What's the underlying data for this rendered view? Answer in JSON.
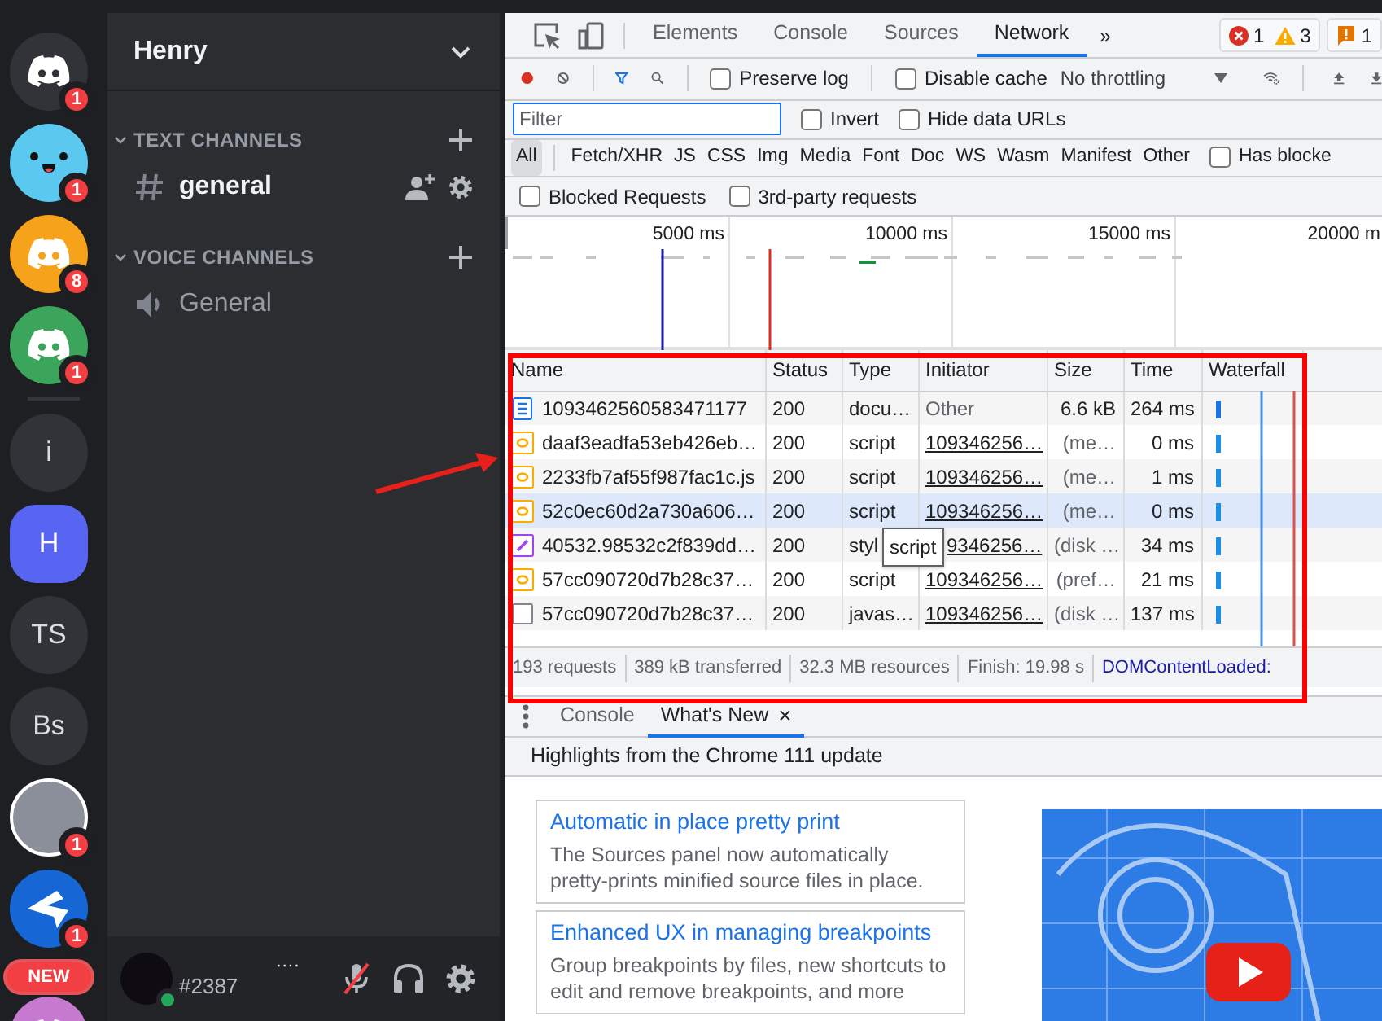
{
  "discord": {
    "servers": [
      {
        "kind": "logo",
        "color": "#313338",
        "badge": "1",
        "selected": false
      },
      {
        "kind": "face",
        "color": "#5bc8f0",
        "badge": "1",
        "selected": false
      },
      {
        "kind": "logo",
        "color": "#f7a21b",
        "badge": "8",
        "selected": false
      },
      {
        "kind": "logo",
        "color": "#3ba55c",
        "badge": "1",
        "selected": false
      },
      {
        "kind": "divider"
      },
      {
        "kind": "text",
        "label": "i",
        "color": "#313338",
        "selected": false
      },
      {
        "kind": "text",
        "label": "H",
        "color": "#5865f2",
        "selected": true
      },
      {
        "kind": "text",
        "label": "TS",
        "color": "#313338",
        "selected": false
      },
      {
        "kind": "text",
        "label": "Bs",
        "color": "#313338",
        "selected": false
      },
      {
        "kind": "photo",
        "badge": "1",
        "selected": false
      },
      {
        "kind": "arrow",
        "color": "#1766d6",
        "badge": "1",
        "selected": false
      },
      {
        "kind": "logo",
        "color": "#c57ad0",
        "pill": "NEW",
        "selected": false
      }
    ],
    "server_name": "Henry",
    "categories": [
      {
        "label": "TEXT CHANNELS",
        "expanded": true,
        "channels": [
          {
            "kind": "text",
            "name": "general",
            "unread": true
          }
        ]
      },
      {
        "label": "VOICE CHANNELS",
        "expanded": true,
        "channels": [
          {
            "kind": "voice",
            "name": "General",
            "unread": false
          }
        ]
      }
    ],
    "user": {
      "name": "····",
      "tag": "#2387",
      "muted": true
    }
  },
  "devtools": {
    "tabs": [
      {
        "label": "Elements",
        "selected": false
      },
      {
        "label": "Console",
        "selected": false
      },
      {
        "label": "Sources",
        "selected": false
      },
      {
        "label": "Network",
        "selected": true
      }
    ],
    "more_tabs": "»",
    "counters": [
      {
        "kind": "error",
        "count": "1"
      },
      {
        "kind": "warning",
        "count": "3"
      },
      {
        "kind": "issue",
        "count": "1"
      }
    ],
    "toolbar": {
      "recording": true,
      "options": [
        {
          "label": "Preserve log",
          "checked": false
        },
        {
          "label": "Disable cache",
          "checked": false
        }
      ],
      "throttling": "No throttling"
    },
    "filter": {
      "placeholder": "Filter",
      "options": [
        {
          "label": "Invert",
          "checked": false
        },
        {
          "label": "Hide data URLs",
          "checked": false
        }
      ]
    },
    "type_filters": [
      {
        "label": "All",
        "selected": true
      },
      {
        "label": "Fetch/XHR",
        "selected": false
      },
      {
        "label": "JS",
        "selected": false
      },
      {
        "label": "CSS",
        "selected": false
      },
      {
        "label": "Img",
        "selected": false
      },
      {
        "label": "Media",
        "selected": false
      },
      {
        "label": "Font",
        "selected": false
      },
      {
        "label": "Doc",
        "selected": false
      },
      {
        "label": "WS",
        "selected": false
      },
      {
        "label": "Wasm",
        "selected": false
      },
      {
        "label": "Manifest",
        "selected": false
      },
      {
        "label": "Other",
        "selected": false
      }
    ],
    "has_blocked": {
      "label": "Has blocke",
      "checked": false
    },
    "request_options": [
      {
        "label": "Blocked Requests",
        "checked": false
      },
      {
        "label": "3rd-party requests",
        "checked": false
      }
    ],
    "overview": {
      "ticks": [
        "5000 ms",
        "10000 ms",
        "15000 ms",
        "20000 m"
      ]
    },
    "table": {
      "columns": [
        "Name",
        "Status",
        "Type",
        "Initiator",
        "Size",
        "Time",
        "Waterfall"
      ],
      "rows": [
        {
          "kind": "document",
          "name": "1093462560583471177",
          "status": "200",
          "type": "docu…",
          "initiator": "Other",
          "initiator_link": false,
          "size": "6.6 kB",
          "time": "264 ms",
          "hovered": false
        },
        {
          "kind": "script",
          "name": "daaf3eadfa53eb426eb…",
          "status": "200",
          "type": "script",
          "initiator": "109346256…",
          "initiator_link": true,
          "size": "(me…",
          "time": "0 ms",
          "hovered": false
        },
        {
          "kind": "script",
          "name": "2233fb7af55f987fac1c.js",
          "status": "200",
          "type": "script",
          "initiator": "109346256…",
          "initiator_link": true,
          "size": "(me…",
          "time": "1 ms",
          "hovered": false
        },
        {
          "kind": "script",
          "name": "52c0ec60d2a730a606…",
          "status": "200",
          "type": "script",
          "initiator": "109346256…",
          "initiator_link": true,
          "size": "(me…",
          "time": "0 ms",
          "hovered": true
        },
        {
          "kind": "stylesheet",
          "name": "40532.98532c2f839dd…",
          "status": "200",
          "type": "styl",
          "tooltip": "script",
          "initiator": "9346256…",
          "initiator_link": true,
          "size": "(disk …",
          "time": "34 ms",
          "hovered": false
        },
        {
          "kind": "script",
          "name": "57cc090720d7b28c37…",
          "status": "200",
          "type": "script",
          "initiator": "109346256…",
          "initiator_link": true,
          "size": "(pref…",
          "time": "21 ms",
          "hovered": false
        },
        {
          "kind": "other",
          "name": "57cc090720d7b28c37…",
          "status": "200",
          "type": "javas…",
          "initiator": "109346256…",
          "initiator_link": true,
          "size": "(disk …",
          "time": "137 ms",
          "hovered": false
        }
      ]
    },
    "summary": [
      {
        "kind": "plain",
        "text": "193 requests"
      },
      {
        "kind": "plain",
        "text": "389 kB transferred"
      },
      {
        "kind": "plain",
        "text": "32.3 MB resources"
      },
      {
        "kind": "plain",
        "text": "Finish: 19.98 s"
      },
      {
        "kind": "event",
        "text": "DOMContentLoaded:"
      }
    ]
  },
  "drawer": {
    "tabs": [
      {
        "label": "Console",
        "selected": false
      },
      {
        "label": "What's New",
        "selected": true,
        "close": "×"
      }
    ],
    "heading": "Highlights from the Chrome 111 update",
    "articles": [
      {
        "title": "Automatic in place pretty print",
        "description": "The Sources panel now automatically pretty-prints minified source files in place."
      },
      {
        "title": "Enhanced UX in managing breakpoints",
        "description": "Group breakpoints by files, new shortcuts to edit and remove breakpoints, and more"
      }
    ]
  }
}
